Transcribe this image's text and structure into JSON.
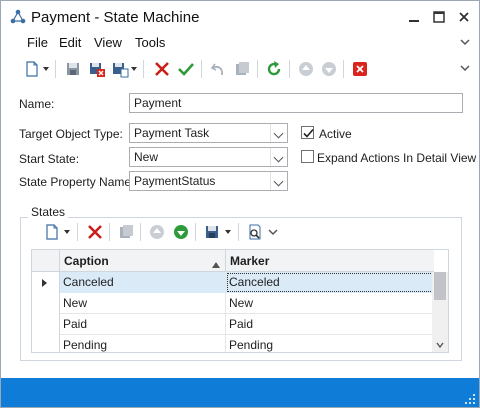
{
  "window": {
    "title": "Payment - State Machine"
  },
  "menu": {
    "file": "File",
    "edit": "Edit",
    "view": "View",
    "tools": "Tools"
  },
  "form": {
    "name_label": "Name:",
    "name_value": "Payment",
    "target_label": "Target Object Type:",
    "target_value": "Payment Task",
    "start_label": "Start State:",
    "start_value": "New",
    "prop_label": "State Property Name:",
    "prop_value": "PaymentStatus",
    "active_label": "Active",
    "active_checked": true,
    "expand_label": "Expand Actions In Detail View",
    "expand_checked": false
  },
  "states": {
    "group_label": "States",
    "columns": [
      "Caption",
      "Marker"
    ],
    "rows": [
      {
        "caption": "Canceled",
        "marker": "Canceled",
        "selected": true
      },
      {
        "caption": "New",
        "marker": "New",
        "selected": false
      },
      {
        "caption": "Paid",
        "marker": "Paid",
        "selected": false
      },
      {
        "caption": "Pending",
        "marker": "Pending",
        "selected": false
      }
    ]
  },
  "colors": {
    "accent": "#0f7dd7",
    "close_red": "#d9251d",
    "save_green": "#2e9a3a",
    "selection": "#dbeaf7"
  }
}
